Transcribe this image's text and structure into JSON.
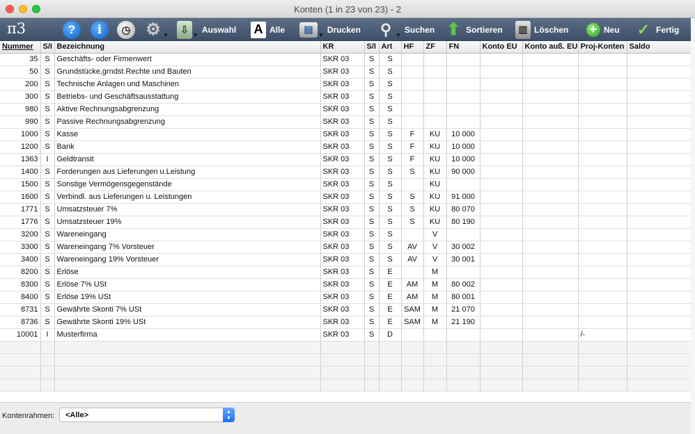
{
  "window": {
    "title": "Konten (1 in 23 von 23) - 2"
  },
  "toolbar": {
    "logo": "π3",
    "select_label": "Auswahl",
    "all_label": "Alle",
    "print_label": "Drucken",
    "search_label": "Suchen",
    "sort_label": "Sortieren",
    "delete_label": "Löschen",
    "new_label": "Neu",
    "done_label": "Fertig"
  },
  "table": {
    "columns": [
      "Nummer",
      "S/I",
      "Bezeichnung",
      "KR",
      "S/I",
      "Art",
      "HF",
      "ZF",
      "FN",
      "Konto EU",
      "Konto auß. EU",
      "Proj-Konten",
      "Saldo"
    ],
    "rows": [
      [
        "35",
        "S",
        "Geschäfts- oder Firmenwert",
        "SKR 03",
        "S",
        "S",
        "",
        "",
        "",
        "",
        "",
        "",
        ""
      ],
      [
        "50",
        "S",
        "Grundstücke,grndst.Rechte und Bauten",
        "SKR 03",
        "S",
        "S",
        "",
        "",
        "",
        "",
        "",
        "",
        ""
      ],
      [
        "200",
        "S",
        "Technische Anlagen und Maschinen",
        "SKR 03",
        "S",
        "S",
        "",
        "",
        "",
        "",
        "",
        "",
        ""
      ],
      [
        "300",
        "S",
        "Betriebs- und Geschäftsausstattung",
        "SKR 03",
        "S",
        "S",
        "",
        "",
        "",
        "",
        "",
        "",
        ""
      ],
      [
        "980",
        "S",
        "Aktive Rechnungsabgrenzung",
        "SKR 03",
        "S",
        "S",
        "",
        "",
        "",
        "",
        "",
        "",
        ""
      ],
      [
        "990",
        "S",
        "Passive Rechnungsabgrenzung",
        "SKR 03",
        "S",
        "S",
        "",
        "",
        "",
        "",
        "",
        "",
        ""
      ],
      [
        "1000",
        "S",
        "Kasse",
        "SKR 03",
        "S",
        "S",
        "F",
        "KU",
        "10 000",
        "",
        "",
        "",
        ""
      ],
      [
        "1200",
        "S",
        "Bank",
        "SKR 03",
        "S",
        "S",
        "F",
        "KU",
        "10 000",
        "",
        "",
        "",
        ""
      ],
      [
        "1363",
        "I",
        "Geldtransit",
        "SKR 03",
        "S",
        "S",
        "F",
        "KU",
        "10 000",
        "",
        "",
        "",
        ""
      ],
      [
        "1400",
        "S",
        "Forderungen aus Lieferungen u.Leistung",
        "SKR 03",
        "S",
        "S",
        "S",
        "KU",
        "90 000",
        "",
        "",
        "",
        ""
      ],
      [
        "1500",
        "S",
        "Sonstige Vermögensgegenstände",
        "SKR 03",
        "S",
        "S",
        "",
        "KU",
        "",
        "",
        "",
        "",
        ""
      ],
      [
        "1600",
        "S",
        "Verbindl. aus Lieferungen u. Leistungen",
        "SKR 03",
        "S",
        "S",
        "S",
        "KU",
        "91 000",
        "",
        "",
        "",
        ""
      ],
      [
        "1771",
        "S",
        "Umsatzsteuer 7%",
        "SKR 03",
        "S",
        "S",
        "S",
        "KU",
        "80 070",
        "",
        "",
        "",
        ""
      ],
      [
        "1776",
        "S",
        "Umsatzsteuer 19%",
        "SKR 03",
        "S",
        "S",
        "S",
        "KU",
        "80 190",
        "",
        "",
        "",
        ""
      ],
      [
        "3200",
        "S",
        "Wareneingang",
        "SKR 03",
        "S",
        "S",
        "",
        "V",
        "",
        "",
        "",
        "",
        ""
      ],
      [
        "3300",
        "S",
        "Wareneingang 7% Vorsteuer",
        "SKR 03",
        "S",
        "S",
        "AV",
        "V",
        "30 002",
        "",
        "",
        "",
        ""
      ],
      [
        "3400",
        "S",
        "Wareneingang 19% Vorsteuer",
        "SKR 03",
        "S",
        "S",
        "AV",
        "V",
        "30 001",
        "",
        "",
        "",
        ""
      ],
      [
        "8200",
        "S",
        "Erlöse",
        "SKR 03",
        "S",
        "E",
        "",
        "M",
        "",
        "",
        "",
        "",
        ""
      ],
      [
        "8300",
        "S",
        "Erlöse 7% USt",
        "SKR 03",
        "S",
        "E",
        "AM",
        "M",
        "80 002",
        "",
        "",
        "",
        ""
      ],
      [
        "8400",
        "S",
        "Erlöse 19% USt",
        "SKR 03",
        "S",
        "E",
        "AM",
        "M",
        "80 001",
        "",
        "",
        "",
        ""
      ],
      [
        "8731",
        "S",
        "Gewährte Skonti 7% USt",
        "SKR 03",
        "S",
        "E",
        "SAM",
        "M",
        "21 070",
        "",
        "",
        "",
        ""
      ],
      [
        "8736",
        "S",
        "Gewährte Skonti 19% USt",
        "SKR 03",
        "S",
        "E",
        "SAM",
        "M",
        "21 190",
        "",
        "",
        "",
        ""
      ],
      [
        "10001",
        "I",
        "Musterfirma",
        "SKR 03",
        "S",
        "D",
        "",
        "",
        "",
        "",
        "",
        "/-",
        ""
      ]
    ]
  },
  "footer": {
    "kontenrahmen_label": "Kontenrahmen:",
    "kontenrahmen_value": "<Alle>"
  }
}
